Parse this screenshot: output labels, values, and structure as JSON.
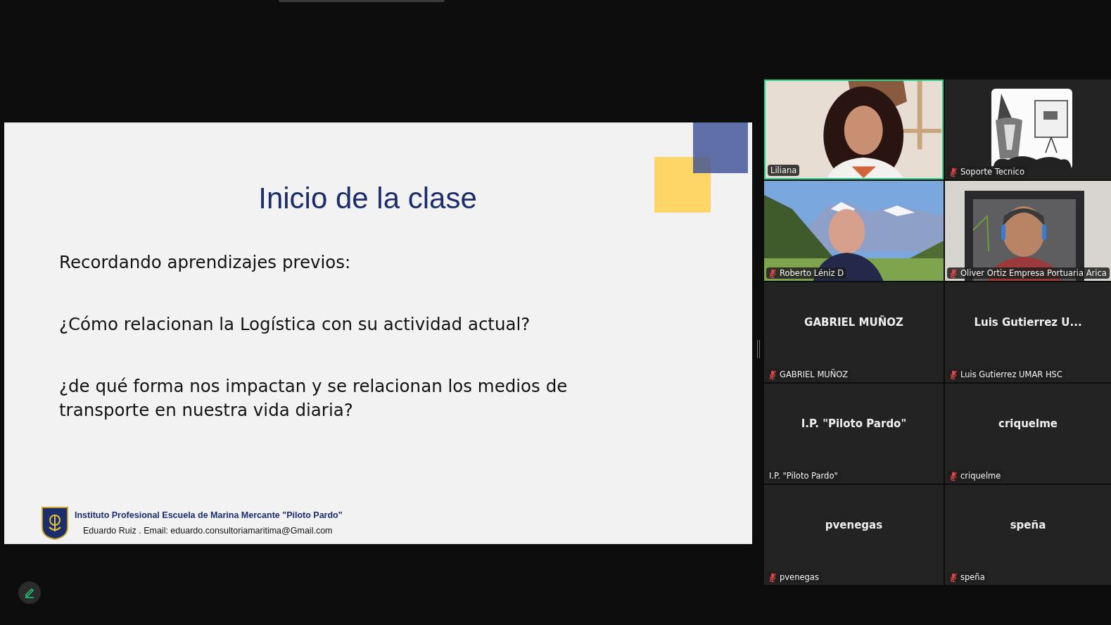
{
  "slide": {
    "title": "Inicio de la clase",
    "lines": [
      "Recordando aprendizajes previos:",
      "¿Cómo relacionan la Logística con su actividad actual?",
      "¿de qué forma nos impactan y se relacionan los medios de transporte en nuestra vida diaria?"
    ],
    "footer": {
      "institution": "Instituto Profesional Escuela de Marina Mercante \"Piloto Pardo\"",
      "contact": "Eduardo Ruiz .  Email: eduardo.consultoriamaritima@Gmail.com"
    }
  },
  "participants": [
    {
      "kind": "picture",
      "name": "Liliana",
      "muted": false,
      "speaking": true
    },
    {
      "kind": "picture",
      "name": "Soporte Tecnico",
      "muted": true,
      "speaking": false
    },
    {
      "kind": "picture",
      "name": "Roberto Léniz D",
      "muted": true,
      "speaking": false
    },
    {
      "kind": "picture",
      "name": "Oliver Ortiz Empresa Portuaria Arica",
      "muted": true,
      "speaking": false
    },
    {
      "kind": "name",
      "heading": "GABRIEL MUÑOZ",
      "name": "GABRIEL MUÑOZ",
      "muted": true,
      "speaking": false
    },
    {
      "kind": "name",
      "heading": "Luis Gutierrez U...",
      "name": "Luis Gutierrez UMAR HSC",
      "muted": true,
      "speaking": false
    },
    {
      "kind": "name",
      "heading": "I.P. \"Piloto Pardo\"",
      "name": "I.P. \"Piloto Pardo\"",
      "muted": false,
      "speaking": false
    },
    {
      "kind": "name",
      "heading": "criquelme",
      "name": "criquelme",
      "muted": true,
      "speaking": false
    },
    {
      "kind": "name",
      "heading": "pvenegas",
      "name": "pvenegas",
      "muted": true,
      "speaking": false
    },
    {
      "kind": "name",
      "heading": "speña",
      "name": "speña",
      "muted": true,
      "speaking": false
    }
  ]
}
